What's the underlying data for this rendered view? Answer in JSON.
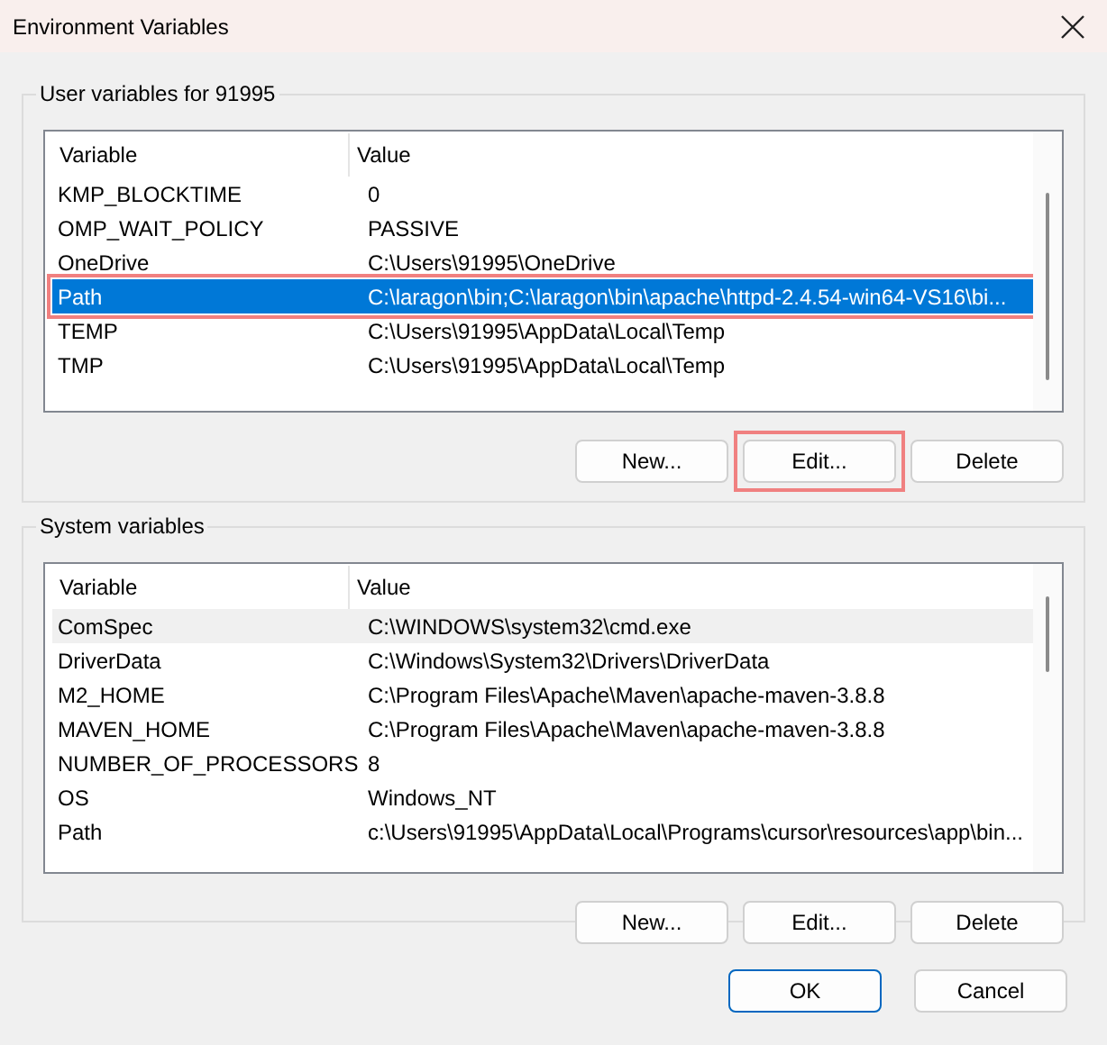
{
  "window": {
    "title": "Environment Variables"
  },
  "groups": [
    {
      "label": "User variables for 91995",
      "columns": [
        "Variable",
        "Value"
      ],
      "rows": [
        {
          "name": "KMP_BLOCKTIME",
          "value": "0",
          "selected": false,
          "hovered": false,
          "highlighted": false
        },
        {
          "name": "OMP_WAIT_POLICY",
          "value": "PASSIVE",
          "selected": false,
          "hovered": false,
          "highlighted": false
        },
        {
          "name": "OneDrive",
          "value": "C:\\Users\\91995\\OneDrive",
          "selected": false,
          "hovered": false,
          "highlighted": false
        },
        {
          "name": "Path",
          "value": "C:\\laragon\\bin;C:\\laragon\\bin\\apache\\httpd-2.4.54-win64-VS16\\bi...",
          "selected": true,
          "hovered": false,
          "highlighted": true
        },
        {
          "name": "TEMP",
          "value": "C:\\Users\\91995\\AppData\\Local\\Temp",
          "selected": false,
          "hovered": false,
          "highlighted": false
        },
        {
          "name": "TMP",
          "value": "C:\\Users\\91995\\AppData\\Local\\Temp",
          "selected": false,
          "hovered": false,
          "highlighted": false
        }
      ],
      "buttons": [
        {
          "label": "New...",
          "highlighted": false
        },
        {
          "label": "Edit...",
          "highlighted": true
        },
        {
          "label": "Delete",
          "highlighted": false
        }
      ]
    },
    {
      "label": "System variables",
      "columns": [
        "Variable",
        "Value"
      ],
      "rows": [
        {
          "name": "ComSpec",
          "value": "C:\\WINDOWS\\system32\\cmd.exe",
          "selected": false,
          "hovered": true,
          "highlighted": false
        },
        {
          "name": "DriverData",
          "value": "C:\\Windows\\System32\\Drivers\\DriverData",
          "selected": false,
          "hovered": false,
          "highlighted": false
        },
        {
          "name": "M2_HOME",
          "value": "C:\\Program Files\\Apache\\Maven\\apache-maven-3.8.8",
          "selected": false,
          "hovered": false,
          "highlighted": false
        },
        {
          "name": "MAVEN_HOME",
          "value": "C:\\Program Files\\Apache\\Maven\\apache-maven-3.8.8",
          "selected": false,
          "hovered": false,
          "highlighted": false
        },
        {
          "name": "NUMBER_OF_PROCESSORS",
          "value": "8",
          "selected": false,
          "hovered": false,
          "highlighted": false
        },
        {
          "name": "OS",
          "value": "Windows_NT",
          "selected": false,
          "hovered": false,
          "highlighted": false
        },
        {
          "name": "Path",
          "value": "c:\\Users\\91995\\AppData\\Local\\Programs\\cursor\\resources\\app\\bin...",
          "selected": false,
          "hovered": false,
          "highlighted": false
        }
      ],
      "buttons": [
        {
          "label": "New...",
          "highlighted": false
        },
        {
          "label": "Edit...",
          "highlighted": false
        },
        {
          "label": "Delete",
          "highlighted": false
        }
      ]
    }
  ],
  "footer_buttons": [
    {
      "label": "OK",
      "default": true
    },
    {
      "label": "Cancel",
      "default": false
    }
  ]
}
